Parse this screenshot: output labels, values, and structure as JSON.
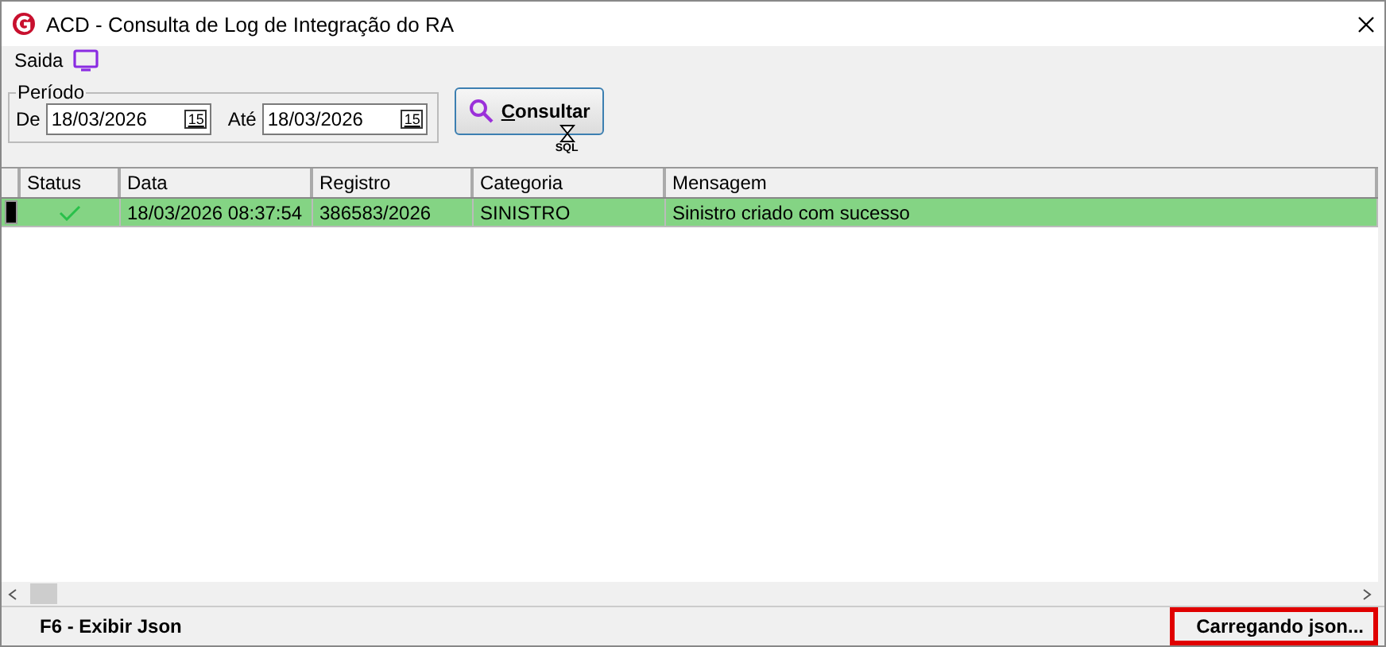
{
  "window": {
    "title": "ACD - Consulta de Log de Integração do RA"
  },
  "menu": [
    {
      "label": "Saida"
    }
  ],
  "period": {
    "legend": "Período",
    "from_label": "De",
    "from_value": "18/03/2026",
    "to_label": "Até",
    "to_value": "18/03/2026",
    "from_calendar": "15",
    "to_calendar": "15"
  },
  "query_button": {
    "label": "Consultar",
    "cursor_label": "SQL"
  },
  "table": {
    "columns": [
      "Status",
      "Data",
      "Registro",
      "Categoria",
      "Mensagem"
    ],
    "rows": [
      {
        "selected": true,
        "success": true,
        "cells": [
          "",
          "18/03/2026 08:37:54",
          "386583/2026",
          "SINISTRO",
          "Sinistro criado com sucesso"
        ]
      }
    ]
  },
  "status_bar": {
    "left": "F6 - Exibir Json",
    "right": "Carregando json...",
    "right_highlighted": true
  }
}
